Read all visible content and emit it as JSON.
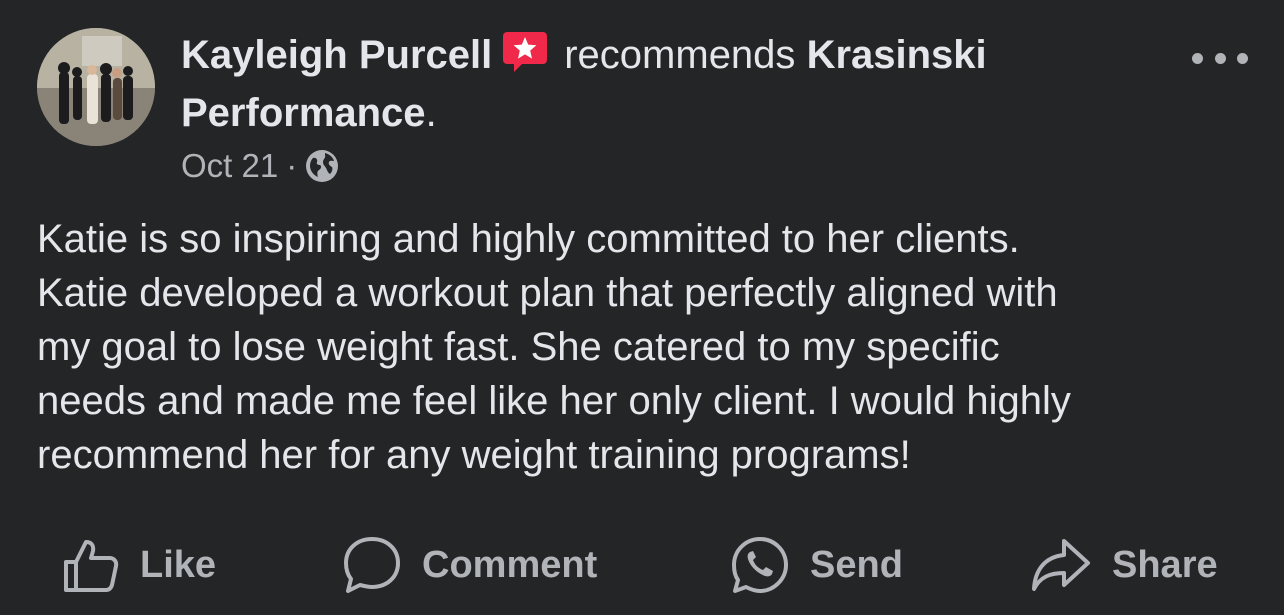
{
  "post": {
    "author": "Kayleigh Purcell",
    "verb": "recommends",
    "page": "Krasinski Performance",
    "period": ".",
    "date": "Oct 21",
    "separator": "·",
    "body": "Katie is so inspiring and highly committed to her clients.\nKatie developed a workout plan that perfectly aligned with\nmy goal to lose weight fast. She catered to my specific\nneeds and made me feel like her only client. I would highly\nrecommend her for any weight training programs!",
    "recommend_badge_color": "#f02849",
    "privacy_icon": "globe-icon"
  },
  "actions": {
    "like": "Like",
    "comment": "Comment",
    "send": "Send",
    "share": "Share"
  },
  "colors": {
    "background": "#242526",
    "primary_text": "#e4e6eb",
    "secondary_text": "#b0b3b8"
  }
}
